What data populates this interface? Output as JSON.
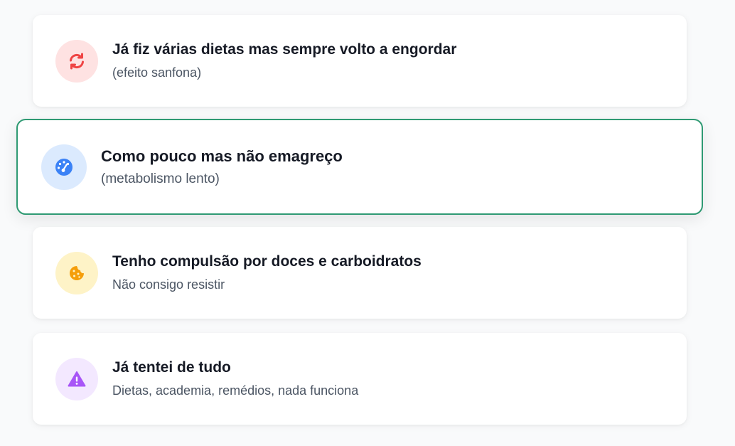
{
  "options": [
    {
      "title": "Já fiz várias dietas mas sempre volto a engordar",
      "subtitle": "(efeito sanfona)",
      "icon": "refresh-icon",
      "icon_color": "#ef4444",
      "icon_bg": "#fee2e2",
      "selected": false
    },
    {
      "title": "Como pouco mas não emagreço",
      "subtitle": "(metabolismo lento)",
      "icon": "gauge-icon",
      "icon_color": "#3b82f6",
      "icon_bg": "#dbeafe",
      "selected": true
    },
    {
      "title": "Tenho compulsão por doces e carboidratos",
      "subtitle": "Não consigo resistir",
      "icon": "cookie-icon",
      "icon_color": "#f59e0b",
      "icon_bg": "#fef3c7",
      "selected": false
    },
    {
      "title": "Já tentei de tudo",
      "subtitle": "Dietas, academia, remédios, nada funciona",
      "icon": "warning-icon",
      "icon_color": "#a855f7",
      "icon_bg": "#f3e8ff",
      "selected": false
    }
  ],
  "accent_color": "#2f9a73"
}
